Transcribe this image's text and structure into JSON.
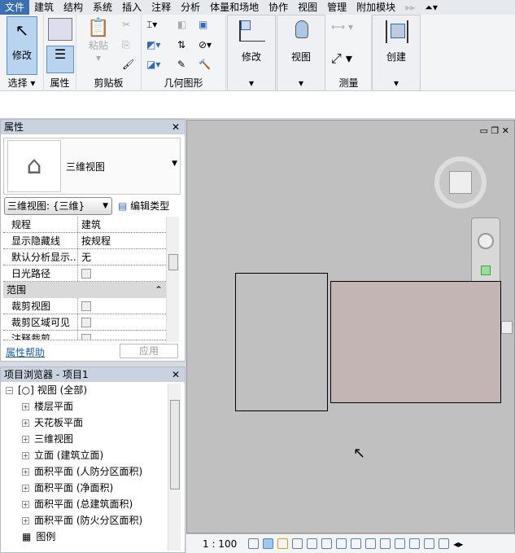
{
  "menu": {
    "items": [
      "文件",
      "建筑",
      "结构",
      "系统",
      "插入",
      "注释",
      "分析",
      "体量和场地",
      "协作",
      "视图",
      "管理",
      "附加模块"
    ]
  },
  "ribbon": {
    "modify_label": "修改",
    "select_label": "选择",
    "properties_label": "属性",
    "paste_label": "粘贴",
    "clipboard_label": "剪贴板",
    "geometry_label": "几何图形",
    "modify_panel_label": "修改",
    "view_panel_label": "视图",
    "measure_label": "测量",
    "create_label": "创建"
  },
  "properties": {
    "title": "属性",
    "type_name": "三维视图",
    "view_selector": "三维视图: {三维}",
    "edit_type": "编辑类型",
    "rows": [
      {
        "k": "规程",
        "v": "建筑"
      },
      {
        "k": "显示隐藏线",
        "v": "按规程"
      },
      {
        "k": "默认分析显示...",
        "v": "无"
      },
      {
        "k": "日光路径",
        "v": ""
      }
    ],
    "section": "范围",
    "rows2": [
      {
        "k": "裁剪视图"
      },
      {
        "k": "裁剪区域可见"
      },
      {
        "k": "注释裁剪"
      }
    ],
    "help": "属性帮助",
    "apply": "应用"
  },
  "browser": {
    "title": "项目浏览器 - 项目1",
    "root": "视图 (全部)",
    "items": [
      "楼层平面",
      "天花板平面",
      "三维视图",
      "立面 (建筑立面)",
      "面积平面 (人防分区面积)",
      "面积平面 (净面积)",
      "面积平面 (总建筑面积)",
      "面积平面 (防火分区面积)"
    ],
    "legend": "图例"
  },
  "status": {
    "scale": "1 : 100"
  }
}
